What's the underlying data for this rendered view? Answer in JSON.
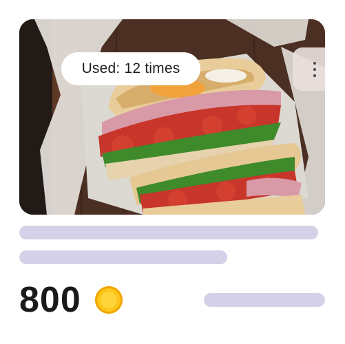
{
  "card": {
    "image_icon": "sandwich-photo",
    "usage_badge": "Used: 12 times",
    "menu_icon": "more-vertical-icon",
    "price": "800",
    "currency_icon": "gold-coin-icon"
  },
  "colors": {
    "skeleton": "#d5d1e8",
    "coin": "#ffc61a",
    "price_text": "#1a1a1a"
  }
}
